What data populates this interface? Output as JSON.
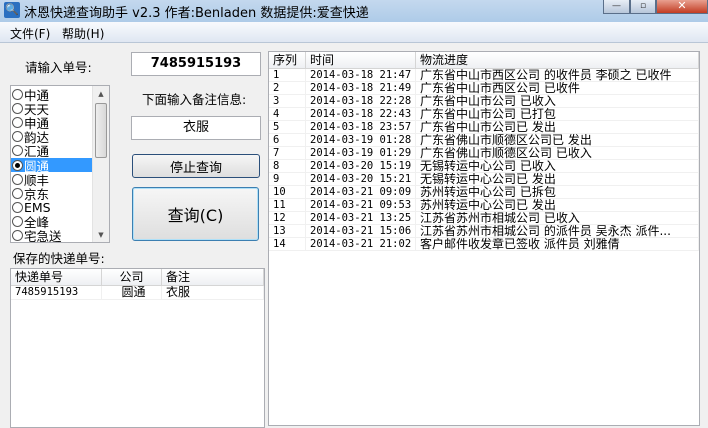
{
  "window": {
    "title": "沐恩快递查询助手 v2.3  作者:Benladen 数据提供:爱查快递",
    "minimize": "—",
    "maximize": "▫",
    "close": "✕"
  },
  "menu": [
    {
      "label": "文件(F)"
    },
    {
      "label": "帮助(H)"
    }
  ],
  "input": {
    "label": "请输入单号:",
    "value": "7485915193"
  },
  "remark": {
    "label": "下面输入备注信息:",
    "value": "衣服"
  },
  "companies": [
    {
      "label": "中通",
      "selected": false
    },
    {
      "label": "天天",
      "selected": false
    },
    {
      "label": "申通",
      "selected": false
    },
    {
      "label": "韵达",
      "selected": false
    },
    {
      "label": "汇通",
      "selected": false
    },
    {
      "label": "圆通",
      "selected": true
    },
    {
      "label": "顺丰",
      "selected": false
    },
    {
      "label": "京东",
      "selected": false
    },
    {
      "label": "EMS",
      "selected": false
    },
    {
      "label": "全峰",
      "selected": false
    },
    {
      "label": "宅急送",
      "selected": false
    }
  ],
  "buttons": {
    "stop": "停止查询",
    "query": "查询(C)"
  },
  "saved": {
    "label": "保存的快递单号:",
    "columns": [
      "快递单号",
      "公司",
      "备注"
    ],
    "rows": [
      [
        "7485915193",
        "圆通",
        "衣服"
      ]
    ]
  },
  "tracking": {
    "columns": [
      "序列",
      "时间",
      "物流进度"
    ],
    "rows": [
      [
        "1",
        "2014-03-18 21:47",
        "广东省中山市西区公司 的收件员 李硕之 已收件"
      ],
      [
        "2",
        "2014-03-18 21:49",
        "广东省中山市西区公司 已收件"
      ],
      [
        "3",
        "2014-03-18 22:28",
        "广东省中山市公司 已收入"
      ],
      [
        "4",
        "2014-03-18 22:43",
        "广东省中山市公司 已打包"
      ],
      [
        "5",
        "2014-03-18 23:57",
        "广东省中山市公司已 发出"
      ],
      [
        "6",
        "2014-03-19 01:28",
        "广东省佛山市顺德区公司已 发出"
      ],
      [
        "7",
        "2014-03-19 01:29",
        "广东省佛山市顺德区公司 已收入"
      ],
      [
        "8",
        "2014-03-20 15:19",
        "无锡转运中心公司 已收入"
      ],
      [
        "9",
        "2014-03-20 15:21",
        "无锡转运中心公司已 发出"
      ],
      [
        "10",
        "2014-03-21 09:09",
        "苏州转运中心公司 已拆包"
      ],
      [
        "11",
        "2014-03-21 09:53",
        "苏州转运中心公司已 发出"
      ],
      [
        "12",
        "2014-03-21 13:25",
        "江苏省苏州市相城公司 已收入"
      ],
      [
        "13",
        "2014-03-21 15:06",
        "江苏省苏州市相城公司 的派件员 吴永杰 派件..."
      ],
      [
        "14",
        "2014-03-21 21:02",
        "客户邮件收发章已签收 派件员 刘雅倩"
      ]
    ]
  }
}
